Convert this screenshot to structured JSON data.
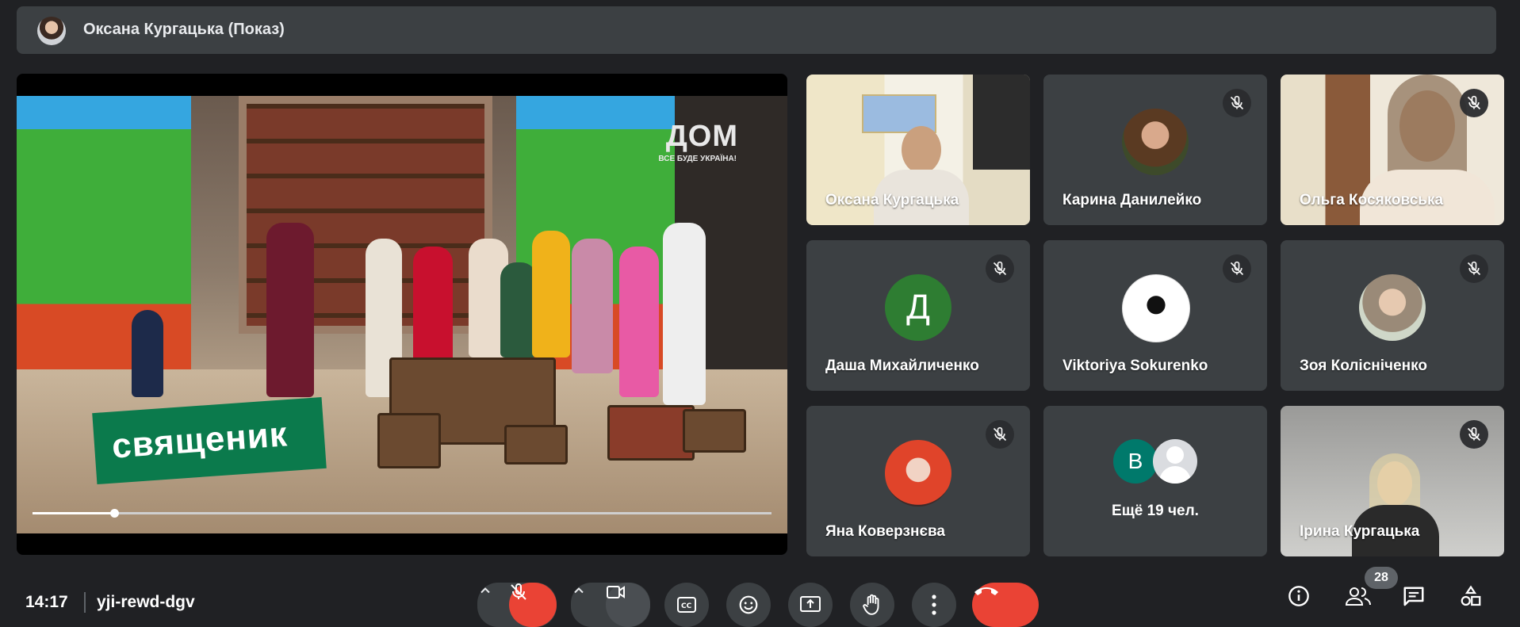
{
  "presenter": {
    "label": "Оксана Кургацька (Показ)"
  },
  "shared_screen": {
    "channel_logo": "ДОМ",
    "channel_tagline": "ВСЕ БУДЕ УКРАЇНА!",
    "caption": "священик",
    "progress_percent": 11
  },
  "participants": [
    {
      "name": "Оксана Кургацька",
      "muted": false,
      "kind": "camera"
    },
    {
      "name": "Карина Данилейко",
      "muted": true,
      "kind": "photo"
    },
    {
      "name": "Ольга Косяковська",
      "muted": true,
      "kind": "camera"
    },
    {
      "name": "Даша Михайличенко",
      "muted": true,
      "kind": "letter",
      "letter": "Д",
      "color": "#2e7d32"
    },
    {
      "name": "Viktoriya Sokurenko",
      "muted": true,
      "kind": "photo"
    },
    {
      "name": "Зоя Колісніченко",
      "muted": true,
      "kind": "photo"
    },
    {
      "name": "Яна Коверзнєва",
      "muted": true,
      "kind": "photo"
    },
    {
      "name": "Ещё 19 чел.",
      "muted": false,
      "kind": "more",
      "letter": "В",
      "color": "#00796b"
    },
    {
      "name": "Ірина Кургацька",
      "muted": true,
      "kind": "camera"
    }
  ],
  "footer": {
    "time": "14:17",
    "meeting_code": "yji-rewd-dgv",
    "people_count": "28"
  },
  "colors": {
    "background": "#202124",
    "tile": "#3c4043",
    "danger": "#ea4335",
    "accent": "#8ab4f8"
  }
}
